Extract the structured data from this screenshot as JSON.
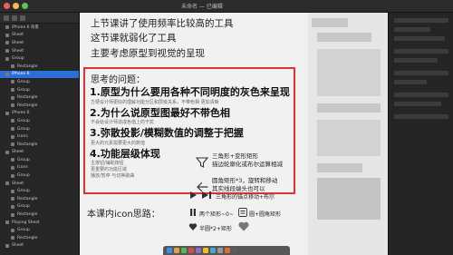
{
  "window": {
    "title": "未命名 — 已编辑"
  },
  "sidebar": {
    "layers": [
      {
        "label": "iPhone 6 背景",
        "selected": false,
        "indent": false
      },
      {
        "label": "Sheet",
        "selected": false,
        "indent": false
      },
      {
        "label": "Sheet",
        "selected": false,
        "indent": false
      },
      {
        "label": "Sheet",
        "selected": false,
        "indent": false
      },
      {
        "label": "Group",
        "selected": false,
        "indent": false
      },
      {
        "label": "Rectangle",
        "selected": false,
        "indent": true
      },
      {
        "label": "iPhone 6",
        "selected": true,
        "indent": false
      },
      {
        "label": "Group",
        "selected": false,
        "indent": true
      },
      {
        "label": "Group",
        "selected": false,
        "indent": true
      },
      {
        "label": "Rectangle",
        "selected": false,
        "indent": true
      },
      {
        "label": "Rectangle",
        "selected": false,
        "indent": true
      },
      {
        "label": "iPhone 6",
        "selected": false,
        "indent": false
      },
      {
        "label": "Group",
        "selected": false,
        "indent": true
      },
      {
        "label": "Group",
        "selected": false,
        "indent": true
      },
      {
        "label": "Icons",
        "selected": false,
        "indent": true
      },
      {
        "label": "Rectangle",
        "selected": false,
        "indent": true
      },
      {
        "label": "Sheet",
        "selected": false,
        "indent": false
      },
      {
        "label": "Group",
        "selected": false,
        "indent": true
      },
      {
        "label": "Icons",
        "selected": false,
        "indent": true
      },
      {
        "label": "Group",
        "selected": false,
        "indent": true
      },
      {
        "label": "Sheet",
        "selected": false,
        "indent": false
      },
      {
        "label": "Group",
        "selected": false,
        "indent": true
      },
      {
        "label": "Rectangle",
        "selected": false,
        "indent": true
      },
      {
        "label": "Group",
        "selected": false,
        "indent": true
      },
      {
        "label": "Rectangle",
        "selected": false,
        "indent": true
      },
      {
        "label": "Playing Sheet",
        "selected": false,
        "indent": false
      },
      {
        "label": "Group",
        "selected": false,
        "indent": true
      },
      {
        "label": "Rectangle",
        "selected": false,
        "indent": true
      },
      {
        "label": "Sheet",
        "selected": false,
        "indent": false
      }
    ]
  },
  "canvas": {
    "intro_lines": [
      "上节课讲了使用频率比较高的工具",
      "这节课就弱化了工具",
      "主要考虑原型到视觉的呈现"
    ],
    "box": {
      "title": "思考的问题：",
      "q1": "1.原型为什么要用各种不同明度的灰色来呈现",
      "q1_sub": "方便设计师更好的理解功能分区和层级关系，不带色相 更加清晰",
      "q2": "2.为什么说原型图最好不带色相",
      "q2_sub": "不会给设计师造成色值上的干扰",
      "q3": "3.弥散投影/模糊数值的调整于把握",
      "q3_sub": "更大的元素需要更大的数值",
      "q4": "4.功能层级体现",
      "q4_sub": [
        "主按钮/辅助按钮",
        "更重要的功能区域",
        "播放/暂停 与切换歌曲"
      ],
      "ann_filter": [
        "三角形+变形矩形",
        "描边轮廓化或布尔运算相减"
      ],
      "ann_arrow": [
        "圆角矩形*3，旋转和移动",
        "其实线段端头也可以"
      ]
    },
    "course_title": "本课内icon思路：",
    "icon_notes": {
      "play_next": "三角形的锚点移动+布尔",
      "pause": "两个矩形~0~",
      "menu": "圆+圆角矩形",
      "heart": "半圆*2+矩形"
    }
  }
}
